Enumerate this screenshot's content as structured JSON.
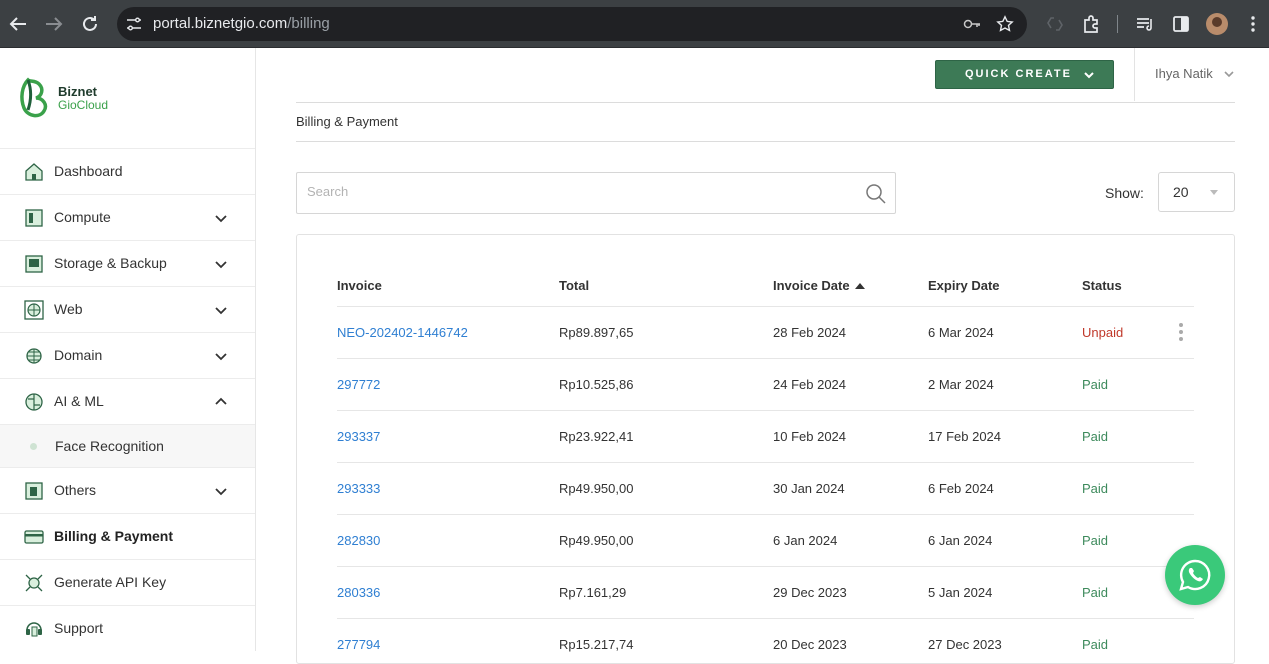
{
  "browser": {
    "url_host": "portal.biznetgio.com",
    "url_path": "/billing"
  },
  "brand": {
    "line1": "Biznet",
    "line2": "GioCloud"
  },
  "sidebar": {
    "items": [
      {
        "label": "Dashboard",
        "icon": "dashboard-icon"
      },
      {
        "label": "Compute",
        "icon": "compute-icon"
      },
      {
        "label": "Storage & Backup",
        "icon": "storage-icon"
      },
      {
        "label": "Web",
        "icon": "web-icon"
      },
      {
        "label": "Domain",
        "icon": "domain-icon"
      },
      {
        "label": "AI & ML",
        "icon": "ai-ml-icon"
      },
      {
        "label": "Face Recognition"
      },
      {
        "label": "Others",
        "icon": "others-icon"
      },
      {
        "label": "Billing & Payment",
        "icon": "billing-icon"
      },
      {
        "label": "Generate API Key",
        "icon": "api-key-icon"
      },
      {
        "label": "Support",
        "icon": "support-icon"
      }
    ]
  },
  "header": {
    "quick_create": "QUICK CREATE",
    "user": "Ihya Natik"
  },
  "breadcrumb": "Billing & Payment",
  "search": {
    "placeholder": "Search"
  },
  "show": {
    "label": "Show:",
    "value": "20"
  },
  "table": {
    "headers": [
      "Invoice",
      "Total",
      "Invoice Date",
      "Expiry Date",
      "Status"
    ],
    "rows": [
      {
        "invoice": "NEO-202402-1446742",
        "total": "Rp89.897,65",
        "invoice_date": "28 Feb 2024",
        "expiry": "6 Mar 2024",
        "status": "Unpaid"
      },
      {
        "invoice": "297772",
        "total": "Rp10.525,86",
        "invoice_date": "24 Feb 2024",
        "expiry": "2 Mar 2024",
        "status": "Paid"
      },
      {
        "invoice": "293337",
        "total": "Rp23.922,41",
        "invoice_date": "10 Feb 2024",
        "expiry": "17 Feb 2024",
        "status": "Paid"
      },
      {
        "invoice": "293333",
        "total": "Rp49.950,00",
        "invoice_date": "30 Jan 2024",
        "expiry": "6 Feb 2024",
        "status": "Paid"
      },
      {
        "invoice": "282830",
        "total": "Rp49.950,00",
        "invoice_date": "6 Jan 2024",
        "expiry": "6 Jan 2024",
        "status": "Paid"
      },
      {
        "invoice": "280336",
        "total": "Rp7.161,29",
        "invoice_date": "29 Dec 2023",
        "expiry": "5 Jan 2024",
        "status": "Paid"
      },
      {
        "invoice": "277794",
        "total": "Rp15.217,74",
        "invoice_date": "20 Dec 2023",
        "expiry": "27 Dec 2023",
        "status": "Paid"
      }
    ]
  },
  "colors": {
    "accent": "#3d7a56",
    "link": "#2f7fd2",
    "paid": "#3d8a5c",
    "unpaid": "#c0392b",
    "whatsapp": "#3ac97a"
  }
}
